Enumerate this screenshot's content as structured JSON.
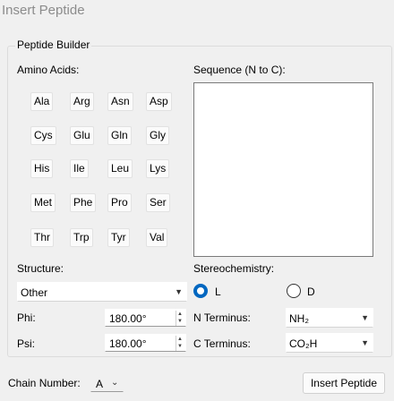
{
  "window": {
    "title": "Insert Peptide"
  },
  "builder": {
    "group_title": "Peptide Builder",
    "amino_acids_label": "Amino Acids:",
    "sequence_label": "Sequence (N to C):",
    "sequence_value": "",
    "amino_acids": [
      [
        "Ala",
        "Arg",
        "Asn",
        "Asp"
      ],
      [
        "Cys",
        "Glu",
        "Gln",
        "Gly"
      ],
      [
        "His",
        "Ile",
        "Leu",
        "Lys"
      ],
      [
        "Met",
        "Phe",
        "Pro",
        "Ser"
      ],
      [
        "Thr",
        "Trp",
        "Tyr",
        "Val"
      ]
    ],
    "structure_label": "Structure:",
    "structure_value": "Other",
    "phi_label": "Phi:",
    "phi_value": "180.00°",
    "psi_label": "Psi:",
    "psi_value": "180.00°",
    "stereo_label": "Stereochemistry:",
    "stereo_options": [
      "L",
      "D"
    ],
    "stereo_selected": "L",
    "n_terminus_label": "N Terminus:",
    "n_terminus_value": "NH₂",
    "c_terminus_label": "C Terminus:",
    "c_terminus_value": "CO₂H"
  },
  "footer": {
    "chain_label": "Chain Number:",
    "chain_value": "A",
    "insert_label": "Insert Peptide"
  }
}
